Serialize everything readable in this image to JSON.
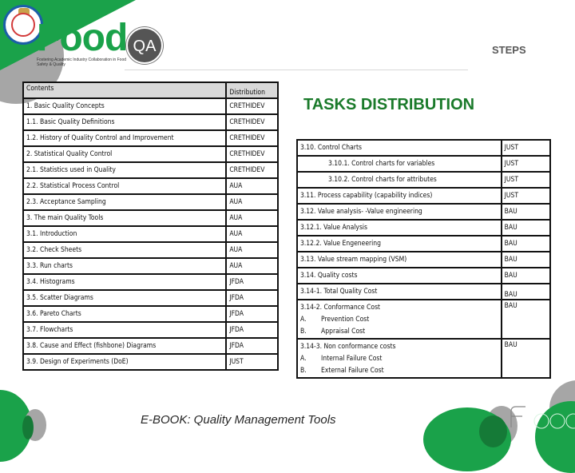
{
  "header": {
    "logo_text": "Food",
    "logo_badge": "QA",
    "logo_tagline": "Fostering Academic Industry Collaboration in Food Safety & Quality",
    "section_label": "STEPS"
  },
  "title": "TASKS DISTRIBUTION",
  "left_table": {
    "headers": [
      "Contents",
      "Distribution"
    ],
    "rows": [
      {
        "content": "1. Basic Quality Concepts",
        "distribution": "CRETHIDEV"
      },
      {
        "content": "1.1. Basic Quality Definitions",
        "distribution": "CRETHIDEV"
      },
      {
        "content": "1.2. History of Quality Control and Improvement",
        "distribution": "CRETHIDEV"
      },
      {
        "content": "2. Statistical Quality Control",
        "distribution": "CRETHIDEV"
      },
      {
        "content": "2.1. Statistics used in Quality",
        "distribution": "CRETHIDEV"
      },
      {
        "content": "2.2. Statistical Process Control",
        "distribution": "AUA"
      },
      {
        "content": "2.3. Acceptance Sampling",
        "distribution": "AUA"
      },
      {
        "content": "3. The main Quality Tools",
        "distribution": "AUA"
      },
      {
        "content": "3.1. Introduction",
        "distribution": "AUA"
      },
      {
        "content": "3.2. Check Sheets",
        "distribution": "AUA"
      },
      {
        "content": "3.3. Run charts",
        "distribution": "AUA"
      },
      {
        "content": "3.4. Histograms",
        "distribution": "JFDA"
      },
      {
        "content": "3.5. Scatter Diagrams",
        "distribution": "JFDA"
      },
      {
        "content": "3.6. Pareto Charts",
        "distribution": "JFDA"
      },
      {
        "content": "3.7. Flowcharts",
        "distribution": "JFDA"
      },
      {
        "content": "3.8. Cause and Effect (fishbone) Diagrams",
        "distribution": "JFDA"
      },
      {
        "content": "3.9. Design of Experiments (DoE)",
        "distribution": "JUST"
      }
    ]
  },
  "right_table": {
    "rows": [
      {
        "content": "3.10. Control Charts",
        "distribution": "JUST"
      },
      {
        "content": "3.10.1. Control charts for variables",
        "distribution": "JUST"
      },
      {
        "content": "3.10.2. Control charts for attributes",
        "distribution": "JUST"
      },
      {
        "content": "3.11. Process capability (capability indices)",
        "distribution": "JUST"
      },
      {
        "content": "3.12. Value analysis- -Value engineering",
        "distribution": "BAU"
      },
      {
        "content": "3.12.1. Value Analysis",
        "distribution": "BAU"
      },
      {
        "content": "3.12.2. Value Engeneering",
        "distribution": "BAU"
      },
      {
        "content": "3.13. Value stream mapping (VSM)",
        "distribution": "BAU"
      },
      {
        "content": "3.14. Quality costs",
        "distribution": "BAU"
      },
      {
        "content": "3.14-1. Total Quality Cost",
        "distribution": "BAU"
      }
    ],
    "conformance": {
      "heading": "3.14-2. Conformance Cost",
      "items": [
        {
          "label": "A.",
          "text": "Prevention Cost"
        },
        {
          "label": "B.",
          "text": "Appraisal Cost"
        }
      ],
      "distribution": "BAU"
    },
    "nonconformance": {
      "heading": "3.14-3. Non conformance costs",
      "items": [
        {
          "label": "A.",
          "text": "Internal Failure  Cost"
        },
        {
          "label": "B.",
          "text": "External Failure Cost"
        }
      ],
      "distribution": "BAU"
    }
  },
  "footer": "E-BOOK: Quality Management Tools",
  "colors": {
    "brand_green": "#1aa24a",
    "title_green": "#1a7a2a",
    "header_gray": "#d9d9d9",
    "decor_gray": "#a6a6a6"
  }
}
